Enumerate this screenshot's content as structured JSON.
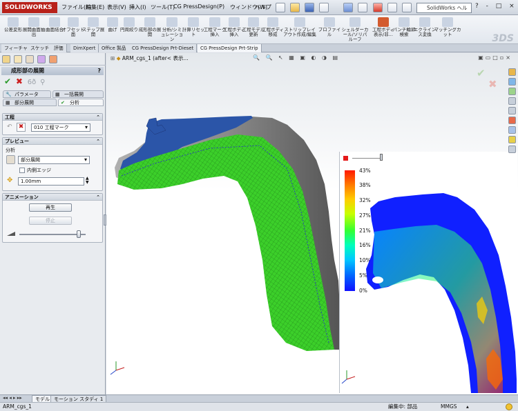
{
  "app": {
    "brand": "SOLIDWORKS",
    "menus": [
      "ファイル(F)",
      "編集(E)",
      "表示(V)",
      "挿入(I)",
      "ツール(T)",
      "CG PressDesign(P)",
      "ウィンドウ(W)",
      "ヘルプ(H)"
    ],
    "search_placeholder": "SolidWorks ヘル",
    "window_controls": "? - □ ×"
  },
  "commands": [
    "公差変形",
    "展開曲面抽出",
    "曲面結合",
    "オフセット面",
    "ステップ展開",
    "曲げ",
    "円周絞り",
    "成形部の展開",
    "分析/シミュレーション",
    "計算リセット",
    "工程マーク挿入",
    "工程ボディ挿入",
    "工程モデル更新",
    "工程ボディ移成",
    "ストリップレイアウト作成/編集",
    "プロファイル",
    "シェルダーカール/ソリパルーフ",
    "工程ボディ表示/非...",
    "パンチ輪郭検索",
    "エクラインス変換",
    "マッチングカット"
  ],
  "tabs": [
    "フィーチャー",
    "スケッチ",
    "評価",
    "DimXpert",
    "Office 製品",
    "CG PressDesign Prt-Dieset",
    "CG PressDesign Prt-Strip"
  ],
  "active_tab_index": 6,
  "panel": {
    "title": "成形部の展開",
    "help": "?",
    "subtabs": [
      "パラメータ",
      "一括展開",
      "部分展開",
      "分析"
    ],
    "process_section": {
      "title": "工程",
      "combo_value": "010 工程マーク"
    },
    "preview_section": {
      "title": "プレビュー",
      "analysis_label": "分析",
      "mode_value": "部分展開",
      "inner_edge_label": "内側エッジ",
      "distance_value": "1.00mm"
    },
    "animation_section": {
      "title": "アニメーション",
      "play_label": "再生",
      "stop_label": "停止"
    }
  },
  "viewport": {
    "doc_label": "ARM_cgs_1  (after< 表示...",
    "hud_icons": "🔍 🔍 ↖ ▦ ▣ ◐ ◑ ▤"
  },
  "contour": {
    "labels": [
      "43%",
      "38%",
      "32%",
      "27%",
      "21%",
      "16%",
      "10%",
      "5%",
      "0%"
    ],
    "max_value_label": "43%",
    "min_value_label": "0%",
    "slider_position": 0.92
  },
  "bottom_tabs": [
    "モデル",
    "モーション スタディ 1"
  ],
  "status": {
    "file": "ARM_cgs_1",
    "mode": "編集中: 部品",
    "units": "MMGS"
  },
  "colors": {
    "brand_red": "#b8211a",
    "part_gray": "#8d8d8d",
    "part_blue": "#2b55a8",
    "formed_green": "#3ccf2a",
    "contour_blue": "#1020ff"
  }
}
